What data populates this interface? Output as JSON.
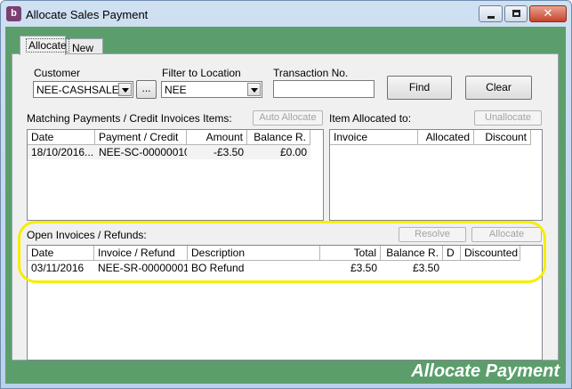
{
  "window": {
    "title": "Allocate Sales Payment",
    "icon": "b",
    "close_glyph": "✕"
  },
  "tabs": [
    {
      "label": "Allocate"
    },
    {
      "label": "New"
    }
  ],
  "filters": {
    "customer_label": "Customer",
    "customer_value": "NEE-CASHSALE",
    "browse_label": "...",
    "location_label": "Filter to Location",
    "location_value": "NEE",
    "transaction_label": "Transaction No.",
    "transaction_value": "",
    "find_label": "Find",
    "clear_label": "Clear"
  },
  "matching": {
    "title": "Matching Payments /  Credit Invoices Items:",
    "auto_allocate_label": "Auto Allocate",
    "columns": [
      "Date",
      "Payment / Credit",
      "Amount",
      "Balance R."
    ],
    "rows": [
      {
        "date": "18/10/2016...",
        "payment": "NEE-SC-00000010",
        "amount": "-£3.50",
        "balance": "£0.00"
      }
    ]
  },
  "allocated": {
    "title": "Item Allocated to:",
    "unallocate_label": "Unallocate",
    "columns": [
      "Invoice",
      "Allocated",
      "Discount"
    ]
  },
  "open_invoices": {
    "title": "Open Invoices / Refunds:",
    "resolve_label": "Resolve",
    "allocate_label": "Allocate",
    "columns": [
      "Date",
      "Invoice / Refund",
      "Description",
      "Total",
      "Balance R.",
      "D",
      "Discounted"
    ],
    "rows": [
      {
        "date": "03/11/2016",
        "invoice": "NEE-SR-00000001",
        "description": "BO Refund",
        "total": "£3.50",
        "balance": "£3.50",
        "d": "",
        "discounted": ""
      }
    ]
  },
  "footer": {
    "title": "Allocate Payment"
  },
  "colors": {
    "frame_green": "#5c9e6b",
    "highlight": "#f5ee00",
    "titlebar": "#cfe0f1"
  }
}
